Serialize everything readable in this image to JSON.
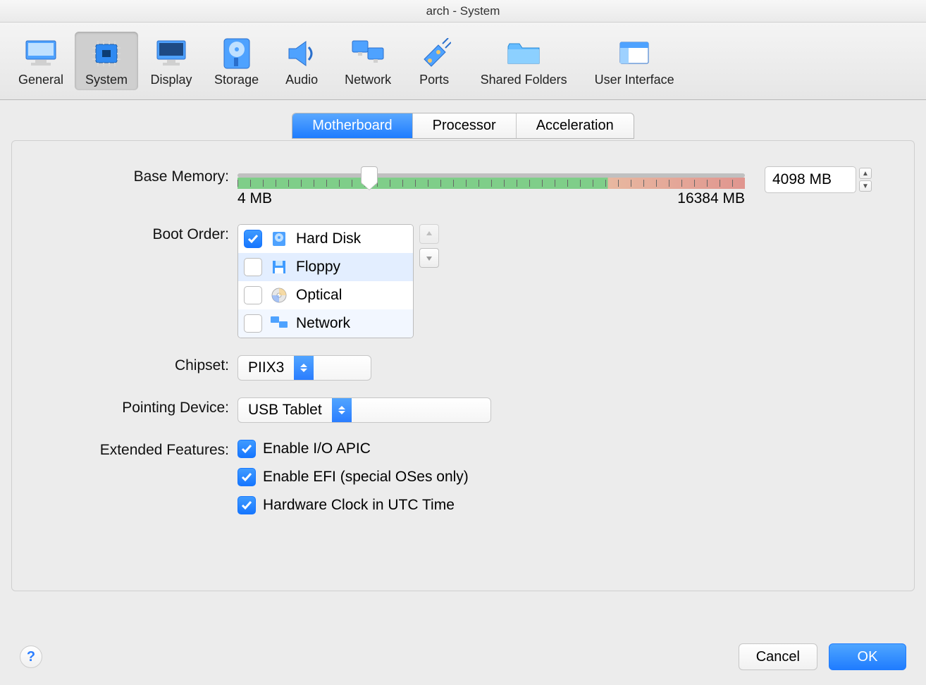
{
  "window_title": "arch - System",
  "toolbar": {
    "items": [
      {
        "label": "General",
        "icon": "monitor-icon",
        "active": false
      },
      {
        "label": "System",
        "icon": "chip-icon",
        "active": true
      },
      {
        "label": "Display",
        "icon": "display-icon",
        "active": false
      },
      {
        "label": "Storage",
        "icon": "harddisk-icon",
        "active": false
      },
      {
        "label": "Audio",
        "icon": "speaker-icon",
        "active": false
      },
      {
        "label": "Network",
        "icon": "network-icon",
        "active": false
      },
      {
        "label": "Ports",
        "icon": "ports-icon",
        "active": false
      },
      {
        "label": "Shared Folders",
        "icon": "folder-icon",
        "active": false
      },
      {
        "label": "User Interface",
        "icon": "ui-icon",
        "active": false
      }
    ]
  },
  "tabs": {
    "items": [
      "Motherboard",
      "Processor",
      "Acceleration"
    ],
    "active": 0
  },
  "form": {
    "base_memory_label": "Base Memory:",
    "base_memory_value": "4098 MB",
    "slider_min_label": "4 MB",
    "slider_max_label": "16384 MB",
    "boot_order_label": "Boot Order:",
    "chipset_label": "Chipset:",
    "chipset_value": "PIIX3",
    "pointing_label": "Pointing Device:",
    "pointing_value": "USB Tablet",
    "extended_label": "Extended Features:",
    "ext_io_apic": "Enable I/O APIC",
    "ext_efi": "Enable EFI (special OSes only)",
    "ext_utc": "Hardware Clock in UTC Time"
  },
  "boot_order": [
    {
      "label": "Hard Disk",
      "checked": true,
      "icon": "harddisk-small-icon"
    },
    {
      "label": "Floppy",
      "checked": false,
      "icon": "floppy-icon"
    },
    {
      "label": "Optical",
      "checked": false,
      "icon": "optical-icon"
    },
    {
      "label": "Network",
      "checked": false,
      "icon": "network-small-icon"
    }
  ],
  "footer": {
    "cancel": "Cancel",
    "ok": "OK"
  }
}
